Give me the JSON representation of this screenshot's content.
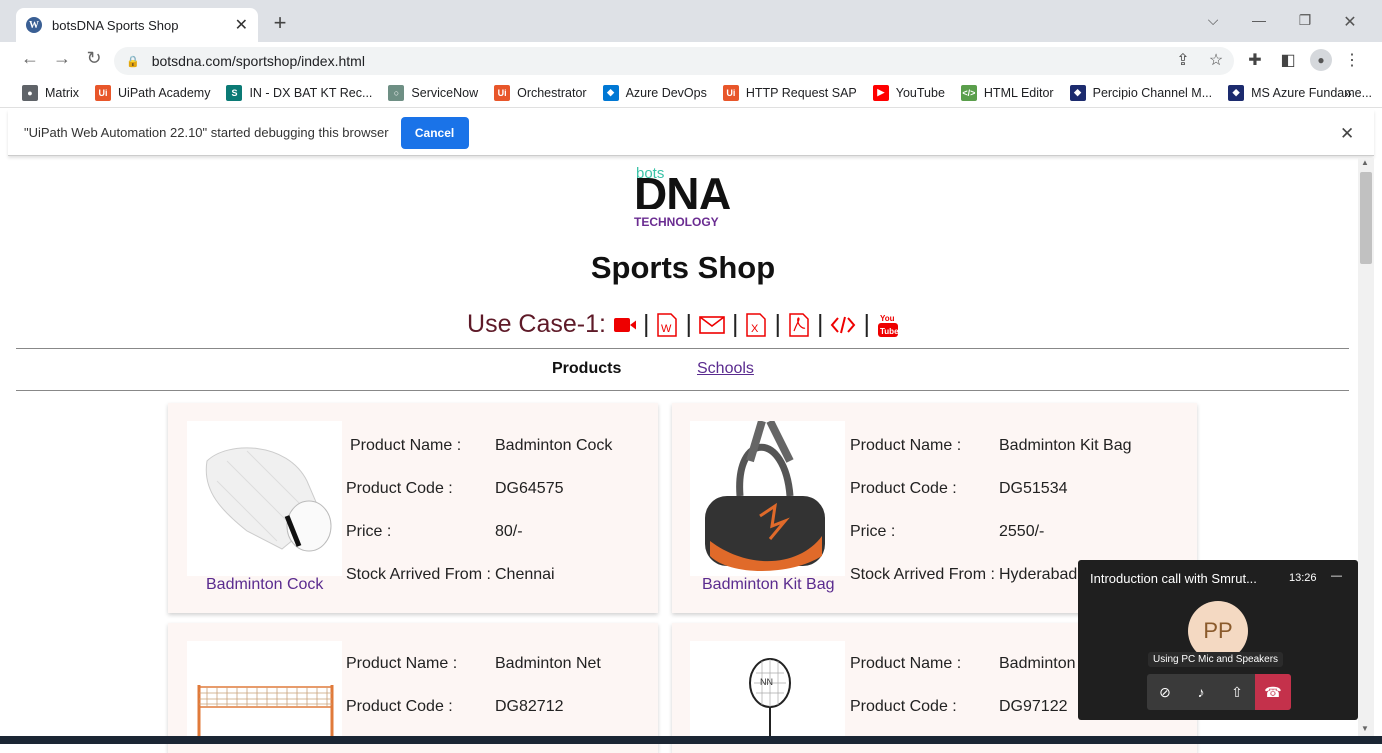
{
  "browser": {
    "tab_title": "botsDNA Sports Shop",
    "tab_close": "✕",
    "new_tab": "+",
    "url": "botsdna.com/sportshop/index.html",
    "bookmarks": [
      {
        "label": "Matrix",
        "icon": "globe-icon",
        "color": "#5f6368",
        "glyph": "●"
      },
      {
        "label": "UiPath Academy",
        "icon": "uipath-icon",
        "color": "#e8562a",
        "glyph": "Ui"
      },
      {
        "label": "IN - DX BAT KT Rec...",
        "icon": "sharepoint-icon",
        "color": "#0b7a75",
        "glyph": "S"
      },
      {
        "label": "ServiceNow",
        "icon": "servicenow-icon",
        "color": "#6e8f84",
        "glyph": "○"
      },
      {
        "label": "Orchestrator",
        "icon": "uipath-icon",
        "color": "#e8562a",
        "glyph": "Ui"
      },
      {
        "label": "Azure DevOps",
        "icon": "azure-devops-icon",
        "color": "#0078d4",
        "glyph": "◆"
      },
      {
        "label": "HTTP Request SAP",
        "icon": "uipath-icon",
        "color": "#e8562a",
        "glyph": "Ui"
      },
      {
        "label": "YouTube",
        "icon": "youtube-icon",
        "color": "#ff0000",
        "glyph": "▶"
      },
      {
        "label": "HTML Editor",
        "icon": "html-editor-icon",
        "color": "#5a9e4b",
        "glyph": "</>"
      },
      {
        "label": "Percipio Channel M...",
        "icon": "percipio-icon",
        "color": "#1c2b6e",
        "glyph": "◆"
      },
      {
        "label": "MS Azure Fundame...",
        "icon": "percipio-icon",
        "color": "#1c2b6e",
        "glyph": "◆"
      }
    ],
    "bookmarks_more": "»"
  },
  "infobar": {
    "message": "\"UiPath Web Automation 22.10\" started debugging this browser",
    "cancel_label": "Cancel",
    "close": "✕"
  },
  "page": {
    "logo": {
      "bots": "bots",
      "dna": "DNA",
      "technology": "TECHNOLOGY"
    },
    "title": "Sports Shop",
    "use_case_label": "Use Case-1:",
    "use_case_icons": [
      "video-icon",
      "word-icon",
      "email-icon",
      "excel-icon",
      "pdf-icon",
      "code-icon",
      "youtube-icon"
    ],
    "nav": {
      "products": "Products",
      "schools": "Schools"
    },
    "field_labels": {
      "name": "Product Name :",
      "code": "Product Code :",
      "price": "Price :",
      "stock": "Stock Arrived From :"
    },
    "products": [
      {
        "name": "Badminton Cock",
        "code": "DG64575",
        "price": "80/-",
        "stock": "Chennai",
        "caption": "Badminton Cock"
      },
      {
        "name": "Badminton Kit Bag",
        "code": "DG51534",
        "price": "2550/-",
        "stock": "Hyderabad",
        "caption": "Badminton Kit Bag"
      },
      {
        "name": "Badminton Net",
        "code": "DG82712"
      },
      {
        "name": "Badminton",
        "code": "DG97122"
      }
    ]
  },
  "meeting": {
    "title": "Introduction call with Smrut...",
    "time": "13:26",
    "minimize": "—",
    "avatar": "PP",
    "status": "Using PC Mic and Speakers",
    "colors": {
      "end_call": "#c4314b",
      "avatar_bg": "#f4d9c2"
    }
  }
}
